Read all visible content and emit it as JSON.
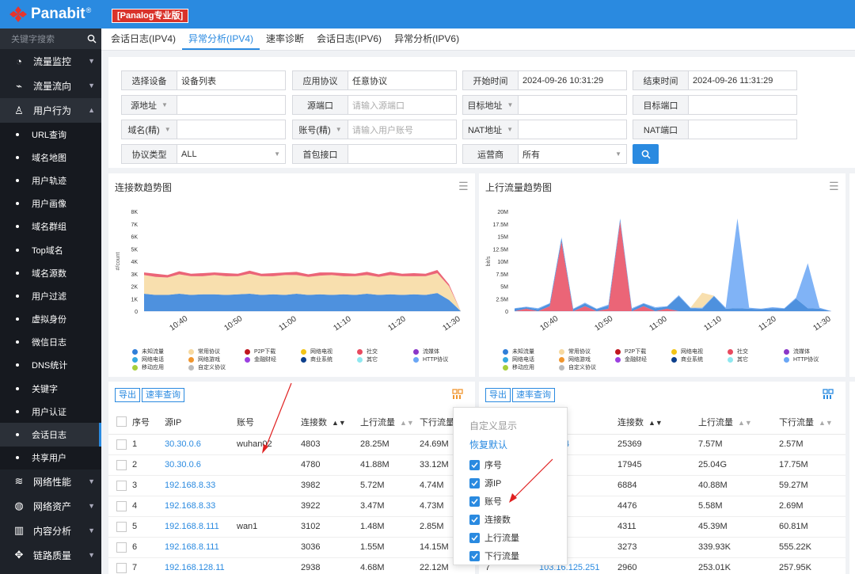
{
  "brand": {
    "name": "Panabit",
    "mark": "®",
    "edition": "[Panalog专业版]"
  },
  "sidebar": {
    "search_placeholder": "关键字搜索",
    "groups_top": [
      {
        "label": "流量监控",
        "icon": "gauge-icon"
      },
      {
        "label": "流量流向",
        "icon": "pulse-icon"
      },
      {
        "label": "用户行为",
        "icon": "user-icon"
      }
    ],
    "subs": [
      "URL查询",
      "域名地图",
      "用户轨迹",
      "用户画像",
      "域名群组",
      "Top域名",
      "域名源数",
      "用户过滤",
      "虚拟身份",
      "微信日志",
      "DNS统计",
      "关键字",
      "用户认证",
      "会话日志",
      "共享用户"
    ],
    "active_sub": "会话日志",
    "groups_bottom": [
      {
        "label": "网络性能",
        "icon": "wifi-icon"
      },
      {
        "label": "网络资产",
        "icon": "globe-icon"
      },
      {
        "label": "内容分析",
        "icon": "book-icon"
      },
      {
        "label": "链路质量",
        "icon": "link-icon"
      }
    ]
  },
  "tabs": [
    "会话日志(IPV4)",
    "异常分析(IPV4)",
    "速率诊断",
    "会话日志(IPV6)",
    "异常分析(IPV6)"
  ],
  "active_tab": "异常分析(IPV4)",
  "filters": {
    "device_label": "选择设备",
    "device_value": "设备列表",
    "proto_label": "应用协议",
    "proto_value": "任意协议",
    "start_label": "开始时间",
    "start_value": "2024-09-26 10:31:29",
    "end_label": "结束时间",
    "end_value": "2024-09-26 11:31:29",
    "src_addr_label": "源地址",
    "src_port_label": "源端口",
    "src_port_placeholder": "请输入源端口",
    "dst_addr_label": "目标地址",
    "dst_port_label": "目标端口",
    "domain_label": "域名(精)",
    "account_label": "账号(精)",
    "account_placeholder": "请输入用户账号",
    "nat_addr_label": "NAT地址",
    "nat_port_label": "NAT端口",
    "proto_type_label": "协议类型",
    "proto_type_value": "ALL",
    "first_pkt_label": "首包接口",
    "isp_label": "运营商",
    "isp_value": "所有"
  },
  "chart1": {
    "title": "连接数趋势图",
    "yticks": [
      "8K",
      "7K",
      "6K",
      "5K",
      "4K",
      "3K",
      "2K",
      "1K",
      "0"
    ],
    "ylabel": "#/count"
  },
  "chart2": {
    "title": "上行流量趋势图",
    "yticks": [
      "20M",
      "17.5M",
      "15M",
      "12.5M",
      "10M",
      "7.5M",
      "5M",
      "2.5M",
      "0"
    ],
    "ylabel": "bit/s"
  },
  "xticks": [
    "10:40",
    "10:50",
    "11:00",
    "11:10",
    "11:20",
    "11:30"
  ],
  "legend": [
    {
      "label": "未知流量",
      "color": "#2f7ed8"
    },
    {
      "label": "常用协议",
      "color": "#f7d9a0"
    },
    {
      "label": "P2P下载",
      "color": "#c0161e"
    },
    {
      "label": "网络电视",
      "color": "#f2c417"
    },
    {
      "label": "社交",
      "color": "#e84a5f"
    },
    {
      "label": "流媒体",
      "color": "#8a36c8"
    },
    {
      "label": "网络电话",
      "color": "#35a8e0"
    },
    {
      "label": "网络游戏",
      "color": "#f0962f"
    },
    {
      "label": "金融财经",
      "color": "#9b40e0"
    },
    {
      "label": "商业系统",
      "color": "#0d3f8c"
    },
    {
      "label": "其它",
      "color": "#8ee8f0"
    },
    {
      "label": "HTTP协议",
      "color": "#6aa6f5"
    },
    {
      "label": "移动应用",
      "color": "#a6cf3a"
    },
    {
      "label": "自定义协议",
      "color": "#bbbbbb"
    }
  ],
  "toolbar": {
    "export": "导出",
    "rate_query": "速率查询"
  },
  "table1": {
    "headers": [
      "序号",
      "源IP",
      "账号",
      "连接数",
      "上行流量",
      "下行流量"
    ],
    "rows": [
      [
        "1",
        "30.30.0.6",
        "wuhan02",
        "4803",
        "28.25M",
        "24.69M"
      ],
      [
        "2",
        "30.30.0.6",
        "",
        "4780",
        "41.88M",
        "33.12M"
      ],
      [
        "3",
        "192.168.8.33",
        "",
        "3982",
        "5.72M",
        "4.74M"
      ],
      [
        "4",
        "192.168.8.33",
        "",
        "3922",
        "3.47M",
        "4.73M"
      ],
      [
        "5",
        "192.168.8.111",
        "wan1",
        "3102",
        "1.48M",
        "2.85M"
      ],
      [
        "6",
        "192.168.8.111",
        "",
        "3036",
        "1.55M",
        "14.15M"
      ],
      [
        "7",
        "192.168.128.11",
        "",
        "2938",
        "4.68M",
        "22.12M"
      ]
    ]
  },
  "table2": {
    "headers": [
      "连接数",
      "上行流量",
      "下行流量"
    ],
    "rows": [
      [
        "114.114",
        "25369",
        "7.57M",
        "2.57M"
      ],
      [
        "100.99",
        "17945",
        "25.04G",
        "17.75M"
      ],
      ".89|6884|40.88M|59.27M",
      [
        "8.129",
        "4476",
        "5.58M",
        "2.69M"
      ],
      [
        "3.11",
        "4311",
        "45.39M",
        "60.81M"
      ],
      [
        "28.214",
        "3273",
        "339.93K",
        "555.22K"
      ],
      [
        "103.16.125.251",
        "2960",
        "253.01K",
        "257.95K"
      ]
    ],
    "row7_index": "7"
  },
  "popup": {
    "title": "自定义显示",
    "reset": "恢复默认",
    "options": [
      "序号",
      "源IP",
      "账号",
      "连接数",
      "上行流量",
      "下行流量"
    ]
  },
  "chart_data": [
    {
      "type": "area",
      "title": "连接数趋势图",
      "ylabel": "#/count",
      "x": [
        "10:32",
        "10:34",
        "10:36",
        "10:38",
        "10:40",
        "10:42",
        "10:44",
        "10:46",
        "10:48",
        "10:50",
        "10:52",
        "10:54",
        "10:56",
        "10:58",
        "11:00",
        "11:02",
        "11:04",
        "11:06",
        "11:08",
        "11:10",
        "11:12",
        "11:14",
        "11:16",
        "11:18",
        "11:20",
        "11:22",
        "11:24",
        "11:26"
      ],
      "series": [
        {
          "name": "未知流量",
          "values": [
            1400,
            1300,
            1300,
            1400,
            1300,
            1350,
            1350,
            1300,
            1350,
            1400,
            1300,
            1350,
            1300,
            1400,
            1300,
            1350,
            1300,
            1350,
            1300,
            1400,
            1300,
            1350,
            1300,
            1350,
            1300,
            1450,
            900,
            0
          ]
        },
        {
          "name": "常用协议",
          "values": [
            1500,
            1450,
            1400,
            1550,
            1500,
            1450,
            1550,
            1500,
            1450,
            1600,
            1500,
            1450,
            1600,
            1500,
            1450,
            1500,
            1600,
            1450,
            1500,
            1500,
            1450,
            1550,
            1500,
            1450,
            1500,
            1600,
            1100,
            0
          ]
        },
        {
          "name": "社交",
          "values": [
            200,
            250,
            200,
            250,
            200,
            250,
            200,
            250,
            200,
            250,
            200,
            250,
            200,
            250,
            200,
            250,
            200,
            250,
            200,
            250,
            200,
            250,
            200,
            250,
            200,
            250,
            150,
            0
          ]
        }
      ],
      "ylim": [
        0,
        8000
      ]
    },
    {
      "type": "area",
      "title": "上行流量趋势图",
      "ylabel": "bit/s",
      "x": [
        "10:32",
        "10:34",
        "10:36",
        "10:38",
        "10:40",
        "10:42",
        "10:44",
        "10:46",
        "10:48",
        "10:50",
        "10:52",
        "10:54",
        "10:56",
        "10:58",
        "11:00",
        "11:02",
        "11:04",
        "11:06",
        "11:08",
        "11:10",
        "11:12",
        "11:14",
        "11:16",
        "11:18",
        "11:20",
        "11:22",
        "11:24",
        "11:26"
      ],
      "series": [
        {
          "name": "社交",
          "values": [
            0,
            500000,
            0,
            1000000,
            14000000,
            0,
            1000000,
            0,
            500000,
            18000000,
            0,
            1000000,
            0,
            500000,
            0,
            0,
            0,
            0,
            0,
            0,
            0,
            0,
            0,
            0,
            0,
            0,
            0,
            0
          ]
        },
        {
          "name": "未知流量",
          "values": [
            500000,
            300000,
            400000,
            500000,
            600000,
            400000,
            500000,
            400000,
            600000,
            500000,
            400000,
            500000,
            600000,
            400000,
            3000000,
            600000,
            500000,
            3000000,
            500000,
            600000,
            500000,
            400000,
            600000,
            500000,
            2500000,
            600000,
            500000,
            0
          ]
        },
        {
          "name": "HTTP协议",
          "values": [
            100000,
            100000,
            200000,
            100000,
            200000,
            100000,
            200000,
            100000,
            200000,
            100000,
            200000,
            100000,
            200000,
            100000,
            200000,
            100000,
            200000,
            100000,
            200000,
            18000000,
            200000,
            100000,
            200000,
            100000,
            200000,
            9000000,
            200000,
            0
          ]
        },
        {
          "name": "常用协议",
          "values": [
            0,
            0,
            0,
            0,
            0,
            0,
            0,
            0,
            0,
            0,
            0,
            0,
            0,
            0,
            0,
            0,
            3000000,
            0,
            0,
            0,
            0,
            0,
            0,
            0,
            0,
            0,
            0,
            0
          ]
        }
      ],
      "ylim": [
        0,
        20000000
      ]
    }
  ]
}
